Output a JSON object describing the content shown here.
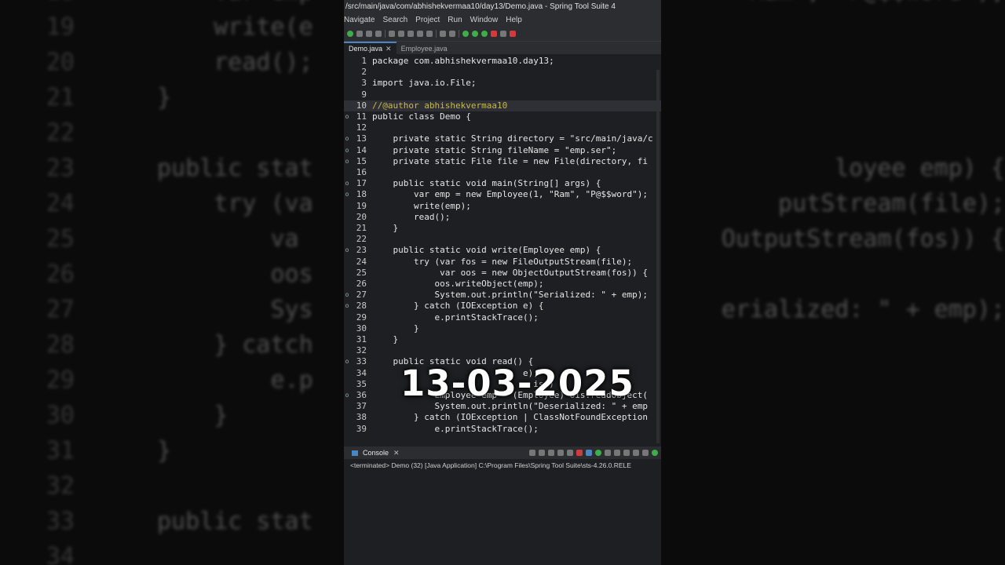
{
  "window": {
    "title": "/src/main/java/com/abhishekvermaa10/day13/Demo.java - Spring Tool Suite 4"
  },
  "menu": [
    "Navigate",
    "Search",
    "Project",
    "Run",
    "Window",
    "Help"
  ],
  "tabs": [
    {
      "label": "Demo.java",
      "active": true
    },
    {
      "label": "Employee.java",
      "active": false
    }
  ],
  "code_lines": [
    {
      "n": "1",
      "text": "package com.abhishekvermaa10.day13;"
    },
    {
      "n": "2",
      "text": ""
    },
    {
      "n": "3",
      "text": "import java.io.File;"
    },
    {
      "n": "9",
      "text": ""
    },
    {
      "n": "10",
      "text": "//@author abhishekvermaa10"
    },
    {
      "n": "11",
      "text": "public class Demo {"
    },
    {
      "n": "12",
      "text": ""
    },
    {
      "n": "13",
      "text": "    private static String directory = \"src/main/java/c"
    },
    {
      "n": "14",
      "text": "    private static String fileName = \"emp.ser\";"
    },
    {
      "n": "15",
      "text": "    private static File file = new File(directory, fi"
    },
    {
      "n": "16",
      "text": ""
    },
    {
      "n": "17",
      "text": "    public static void main(String[] args) {"
    },
    {
      "n": "18",
      "text": "        var emp = new Employee(1, \"Ram\", \"P@$$word\");"
    },
    {
      "n": "19",
      "text": "        write(emp);"
    },
    {
      "n": "20",
      "text": "        read();"
    },
    {
      "n": "21",
      "text": "    }"
    },
    {
      "n": "22",
      "text": ""
    },
    {
      "n": "23",
      "text": "    public static void write(Employee emp) {"
    },
    {
      "n": "24",
      "text": "        try (var fos = new FileOutputStream(file);"
    },
    {
      "n": "25",
      "text": "             var oos = new ObjectOutputStream(fos)) {"
    },
    {
      "n": "26",
      "text": "            oos.writeObject(emp);"
    },
    {
      "n": "27",
      "text": "            System.out.println(\"Serialized: \" + emp);"
    },
    {
      "n": "28",
      "text": "        } catch (IOException e) {"
    },
    {
      "n": "29",
      "text": "            e.printStackTrace();"
    },
    {
      "n": "30",
      "text": "        }"
    },
    {
      "n": "31",
      "text": "    }"
    },
    {
      "n": "32",
      "text": ""
    },
    {
      "n": "33",
      "text": "    public static void read() {"
    },
    {
      "n": "34",
      "text": "                             e);"
    },
    {
      "n": "35",
      "text": "                               is)) {"
    },
    {
      "n": "36",
      "text": "            Employee emp = (Employee) ois.readObject("
    },
    {
      "n": "37",
      "text": "            System.out.println(\"Deserialized: \" + emp"
    },
    {
      "n": "38",
      "text": "        } catch (IOException | ClassNotFoundException"
    },
    {
      "n": "39",
      "text": "            e.printStackTrace();"
    }
  ],
  "overlay_date": "13-03-2025",
  "console": {
    "tab_label": "Console",
    "status": "<terminated> Demo (32) [Java Application] C:\\Program Files\\Spring Tool Suite\\sts-4.26.0.RELE"
  },
  "background": {
    "numbers": [
      "18",
      "19",
      "20",
      "21",
      "22",
      "23",
      "24",
      "25",
      "26",
      "27",
      "28",
      "29",
      "30",
      "31",
      "32",
      "33",
      "34"
    ],
    "left_code": [
      "    var emp",
      "    write(e",
      "    read();",
      "}",
      "",
      "public stat",
      "    try (va",
      "        va",
      "        oos",
      "        Sys",
      "    } catch",
      "        e.p",
      "    }",
      "}",
      "",
      "public stat",
      ""
    ],
    "right_code": [
      "\"Ram\", \"P@$$word\");",
      "",
      "",
      "",
      "",
      "loyee emp) {",
      "putStream(file);",
      "OutputStream(fos)) {",
      "",
      "erialized: \" + emp);",
      "",
      "",
      "",
      "",
      "",
      "",
      ""
    ]
  }
}
